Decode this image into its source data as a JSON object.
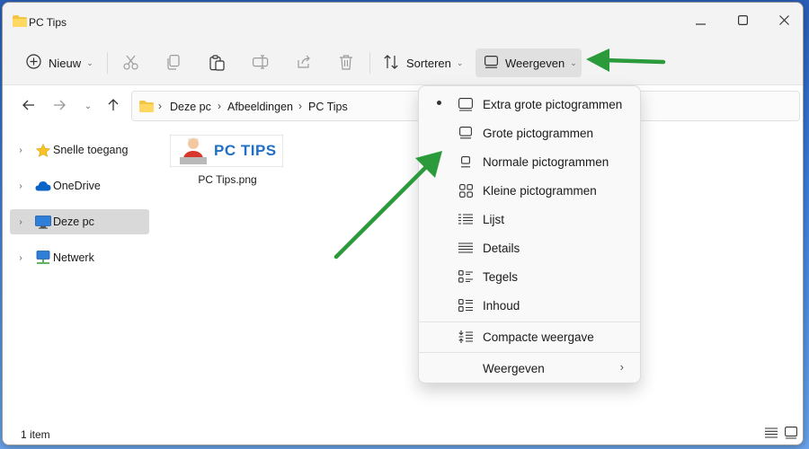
{
  "window": {
    "title": "PC Tips"
  },
  "titlebar": {
    "minimize_icon": "minimize-icon",
    "maximize_icon": "maximize-icon",
    "close_icon": "close-icon"
  },
  "toolbar": {
    "new_label": "Nieuw",
    "sort_label": "Sorteren",
    "view_label": "Weergeven",
    "icons": [
      "cut-icon",
      "copy-icon",
      "paste-icon",
      "rename-icon",
      "share-icon",
      "delete-icon"
    ]
  },
  "address": {
    "crumbs": [
      "Deze pc",
      "Afbeeldingen",
      "PC Tips"
    ]
  },
  "sidebar": {
    "items": [
      {
        "label": "Snelle toegang",
        "icon": "star-icon"
      },
      {
        "label": "OneDrive",
        "icon": "cloud-icon"
      },
      {
        "label": "Deze pc",
        "icon": "monitor-icon",
        "selected": true
      },
      {
        "label": "Netwerk",
        "icon": "network-icon"
      }
    ]
  },
  "content": {
    "file": {
      "name": "PC Tips.png",
      "thumb_text": "PC TIPS"
    }
  },
  "status": {
    "count": "1 item"
  },
  "view_menu": {
    "items": [
      {
        "label": "Extra grote pictogrammen",
        "icon": "extra-large-icons-icon",
        "checked": true
      },
      {
        "label": "Grote pictogrammen",
        "icon": "large-icons-icon"
      },
      {
        "label": "Normale pictogrammen",
        "icon": "medium-icons-icon"
      },
      {
        "label": "Kleine pictogrammen",
        "icon": "small-icons-icon"
      },
      {
        "label": "Lijst",
        "icon": "list-icon"
      },
      {
        "label": "Details",
        "icon": "details-icon"
      },
      {
        "label": "Tegels",
        "icon": "tiles-icon"
      },
      {
        "label": "Inhoud",
        "icon": "content-icon"
      }
    ],
    "compact_label": "Compacte weergave",
    "submenu_label": "Weergeven"
  },
  "colors": {
    "accent": "#0a64c8",
    "arrow": "#2a9a3a",
    "thumb_text": "#1f6fc5"
  }
}
